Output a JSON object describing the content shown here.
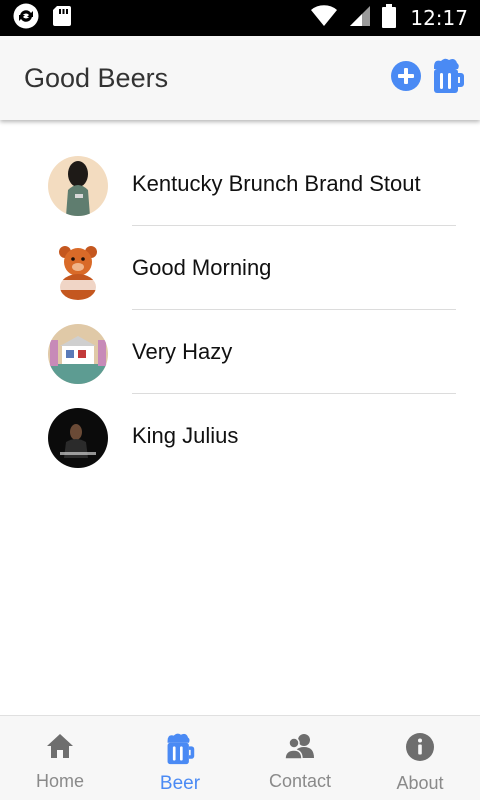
{
  "status_bar": {
    "time": "12:17",
    "icons": [
      "sync-icon",
      "sd-card-icon",
      "wifi-icon",
      "signal-icon",
      "battery-icon"
    ]
  },
  "app_bar": {
    "title": "Good Beers",
    "actions": [
      "add-circle-icon",
      "beer-mug-icon"
    ],
    "accent": "#4a8af4"
  },
  "beers": [
    {
      "name": "Kentucky Brunch Brand Stout",
      "avatar": "avatar-figure"
    },
    {
      "name": "Good Morning",
      "avatar": "avatar-teddy-bear"
    },
    {
      "name": "Very Hazy",
      "avatar": "avatar-house"
    },
    {
      "name": "King Julius",
      "avatar": "avatar-dark-portrait"
    }
  ],
  "tabs": [
    {
      "label": "Home",
      "icon": "home-icon",
      "active": false
    },
    {
      "label": "Beer",
      "icon": "beer-mug-icon",
      "active": true
    },
    {
      "label": "Contact",
      "icon": "contacts-icon",
      "active": false
    },
    {
      "label": "About",
      "icon": "info-icon",
      "active": false
    }
  ],
  "colors": {
    "active_tab": "#4a8af4",
    "inactive_tab": "#8a8a8a",
    "icon_gray": "#6e6e6e"
  }
}
